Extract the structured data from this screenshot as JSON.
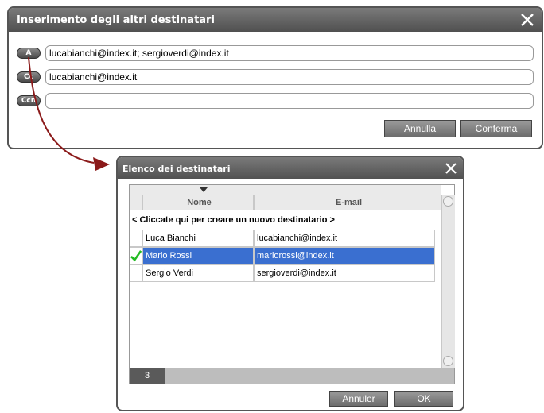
{
  "dialog1": {
    "title": "Inserimento degli altri destinatari",
    "fields": [
      {
        "label": "A",
        "value": "lucabianchi@index.it; sergioverdi@index.it"
      },
      {
        "label": "Cc",
        "value": "lucabianchi@index.it"
      },
      {
        "label": "Ccn",
        "value": ""
      }
    ],
    "cancel_label": "Annulla",
    "confirm_label": "Conferma"
  },
  "dialog2": {
    "title": "Elenco dei destinatari",
    "columns": [
      "Nome",
      "E-mail"
    ],
    "new_row_label": "< Cliccate qui per creare un nuovo destinatario >",
    "rows": [
      {
        "name": "Luca Bianchi",
        "email": "lucabianchi@index.it",
        "selected": false,
        "checked": false
      },
      {
        "name": "Mario Rossi",
        "email": "mariorossi@index.it",
        "selected": true,
        "checked": true
      },
      {
        "name": "Sergio Verdi",
        "email": "sergioverdi@index.it",
        "selected": false,
        "checked": false
      }
    ],
    "count": "3",
    "cancel_label": "Annuler",
    "ok_label": "OK"
  },
  "colors": {
    "selection": "#3a6fd0",
    "check": "#22bb22",
    "arrow": "#8b1a1a"
  },
  "icons": {
    "close": "close-icon",
    "sort": "sort-down-icon",
    "check": "check-icon"
  }
}
